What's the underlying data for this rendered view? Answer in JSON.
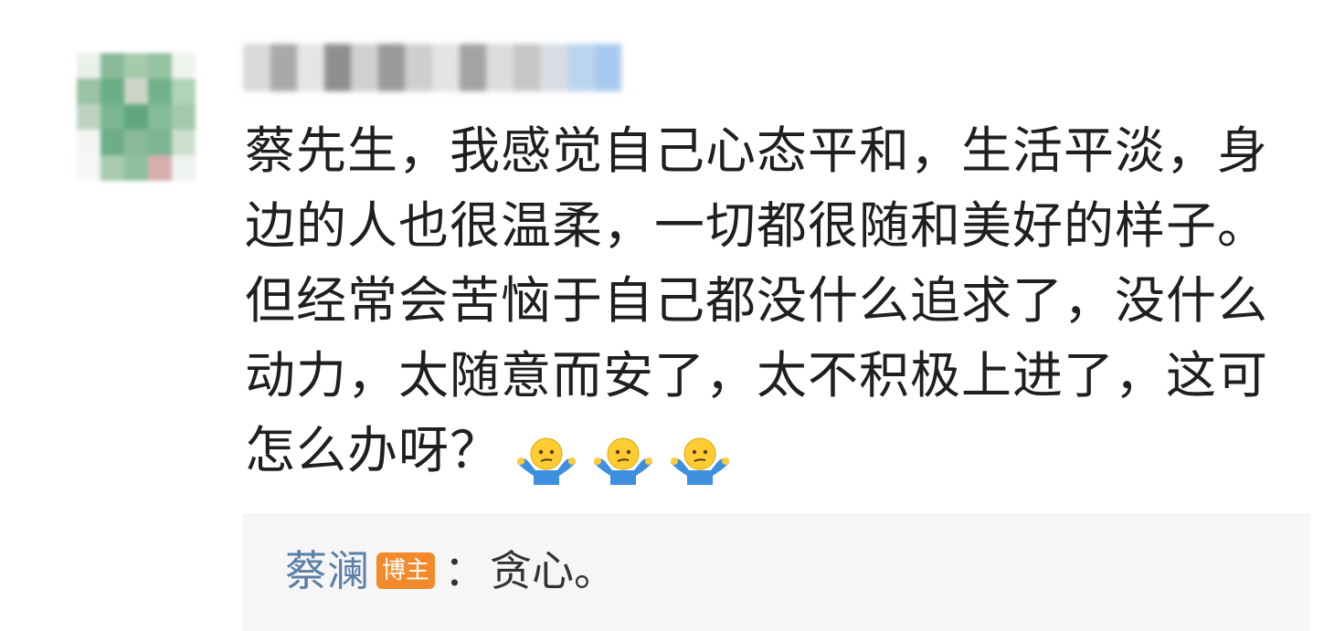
{
  "comment": {
    "username": "",
    "text": "蔡先生，我感觉自己心态平和，生活平淡，身边的人也很温柔，一切都很随和美好的样子。但经常会苦恼于自己都没什么追求了，没什么动力，太随意而安了，太不积极上进了，这可怎么办呀？",
    "emoji": [
      "shrug-emoji",
      "shrug-emoji",
      "shrug-emoji"
    ]
  },
  "reply": {
    "author": "蔡澜",
    "badge": "博主",
    "separator": "：",
    "text": "贪心。"
  },
  "colors": {
    "reply_name": "#5c7fa8",
    "badge_bg": "#f28a2c",
    "reply_bg": "#f6f6f6"
  }
}
